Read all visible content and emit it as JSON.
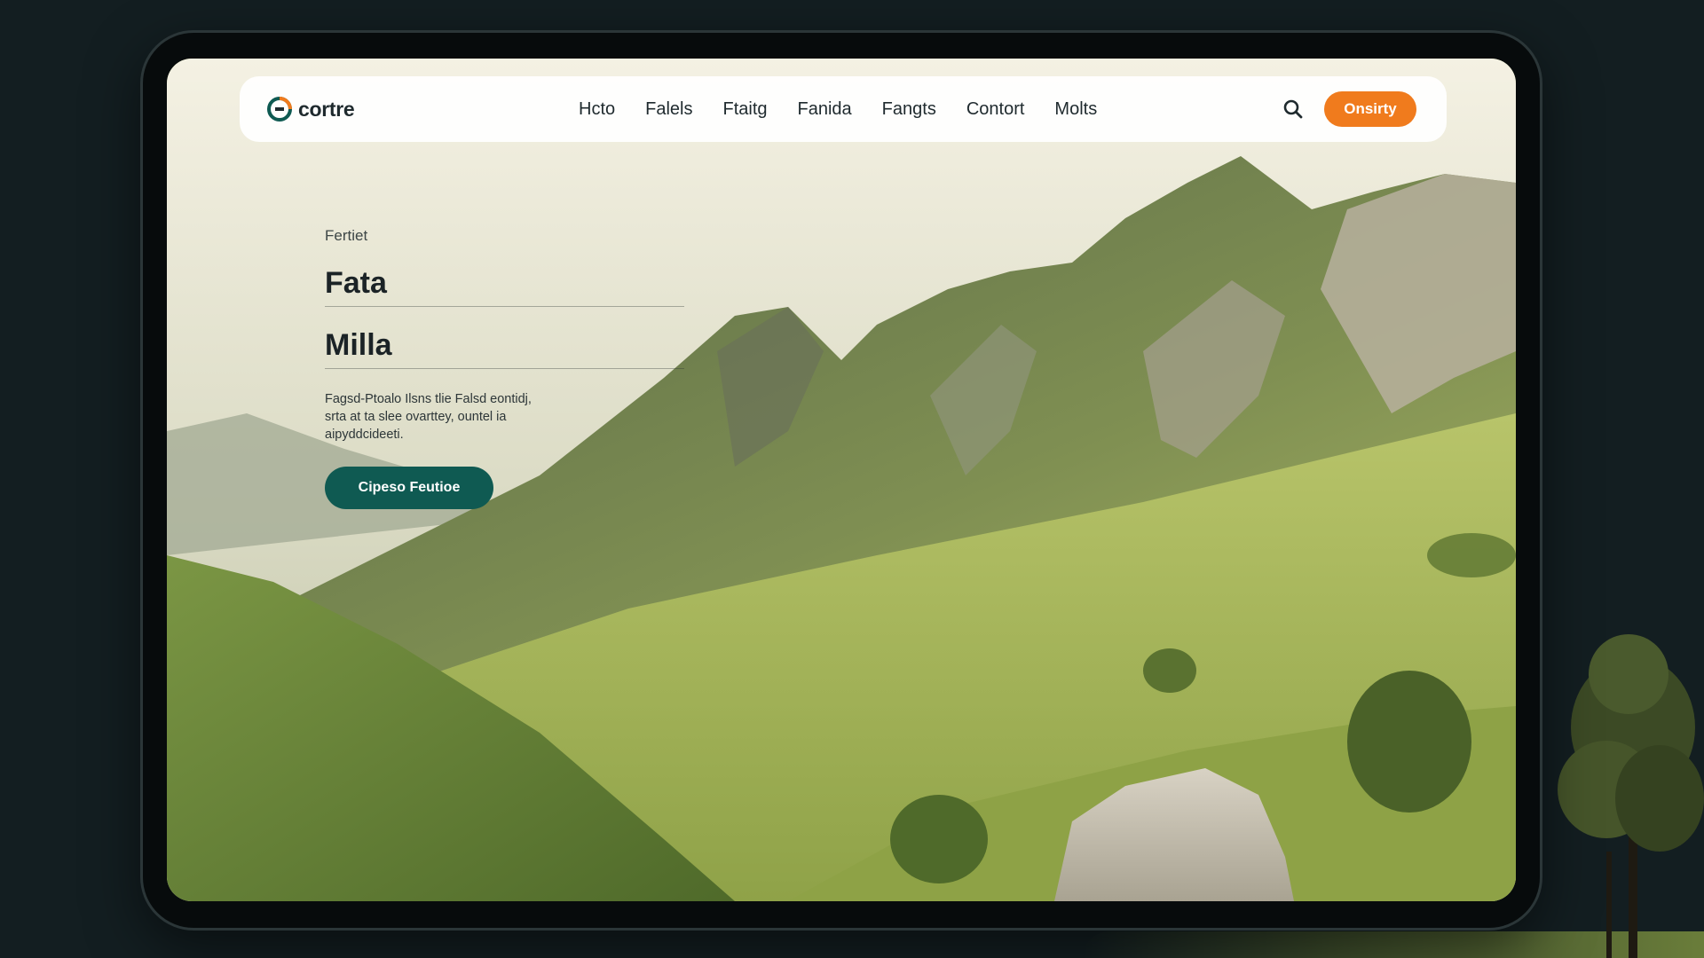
{
  "navbar": {
    "logo_text": "cortre",
    "links": [
      {
        "label": "Hcto"
      },
      {
        "label": "Falels"
      },
      {
        "label": "Ftaitg"
      },
      {
        "label": "Fanida"
      },
      {
        "label": "Fangts"
      },
      {
        "label": "Contort"
      },
      {
        "label": "Molts"
      }
    ],
    "cta_label": "Onsirty"
  },
  "hero": {
    "eyebrow": "Fertiet",
    "title_line_1": "Fata",
    "title_line_2": "Milla",
    "description": "Fagsd-Ptoalo Ilsns tlie Falsd eontidj, srta at ta slee ovarttey, ountel ia aipyddcideeti.",
    "button_label": "Cipeso Feutioe"
  },
  "colors": {
    "accent_orange": "#f07b1d",
    "primary_teal": "#0f5a52",
    "frame_dark": "#070b0c",
    "background": "#131e21"
  },
  "icons": {
    "logo": "logo-mark-icon",
    "search": "search-icon"
  }
}
